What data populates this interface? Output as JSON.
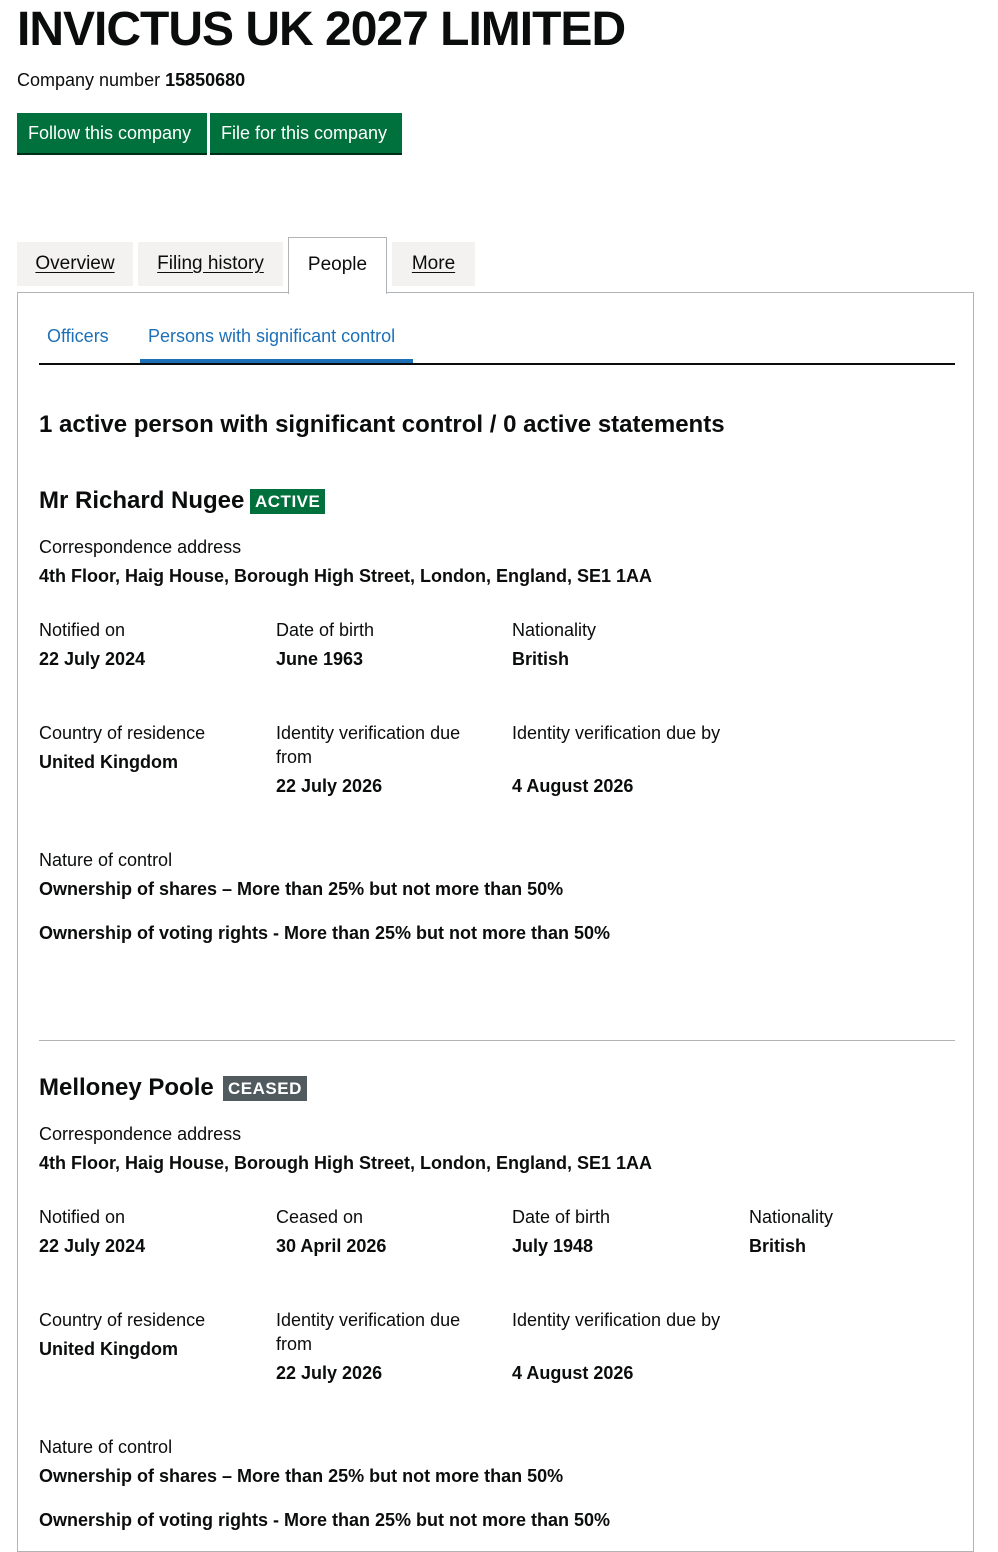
{
  "company": {
    "name": "INVICTUS UK 2027 LIMITED",
    "number_label": "Company number",
    "number": "15850680"
  },
  "actions": {
    "follow": "Follow this company",
    "file": "File for this company"
  },
  "tabs": [
    {
      "label": "Overview",
      "selected": false
    },
    {
      "label": "Filing history",
      "selected": false
    },
    {
      "label": "People",
      "selected": true
    },
    {
      "label": "More",
      "selected": false
    }
  ],
  "subnav": {
    "officers": "Officers",
    "psc": "Persons with significant control",
    "selected": "Persons with significant control"
  },
  "summary_heading": "1 active person with significant control / 0 active statements",
  "persons": [
    {
      "name": "Mr Richard Nugee",
      "status": "ACTIVE",
      "address_label": "Correspondence address",
      "address": "4th Floor, Haig House, Borough High Street, London, England, SE1 1AA",
      "notified_label": "Notified on",
      "notified": "22 July 2024",
      "dob_label": "Date of birth",
      "dob": "June 1963",
      "nationality_label": "Nationality",
      "nationality": "British",
      "residence_label": "Country of residence",
      "residence": "United Kingdom",
      "idv_from_label": "Identity verification due from",
      "idv_from": "22 July 2026",
      "idv_by_label": "Identity verification due by",
      "idv_by": "4 August 2026",
      "nature_label": "Nature of control",
      "nature": [
        "Ownership of shares – More than 25% but not more than 50%",
        "Ownership of voting rights - More than 25% but not more than 50%"
      ]
    },
    {
      "name": "Melloney Poole",
      "status": "CEASED",
      "address_label": "Correspondence address",
      "address": "4th Floor, Haig House, Borough High Street, London, England, SE1 1AA",
      "notified_label": "Notified on",
      "notified": "22 July 2024",
      "ceased_label": "Ceased on",
      "ceased": "30 April 2026",
      "dob_label": "Date of birth",
      "dob": "July 1948",
      "nationality_label": "Nationality",
      "nationality": "British",
      "residence_label": "Country of residence",
      "residence": "United Kingdom",
      "idv_from_label": "Identity verification due from",
      "idv_from": "22 July 2026",
      "idv_by_label": "Identity verification due by",
      "idv_by": "4 August 2026",
      "nature_label": "Nature of control",
      "nature": [
        "Ownership of shares – More than 25% but not more than 50%",
        "Ownership of voting rights - More than 25% but not more than 50%"
      ]
    }
  ],
  "colors": {
    "button_green": "#00703c",
    "link_blue": "#1d70b8",
    "ceased_grey": "#505a5f",
    "text": "#0b0c0c"
  }
}
